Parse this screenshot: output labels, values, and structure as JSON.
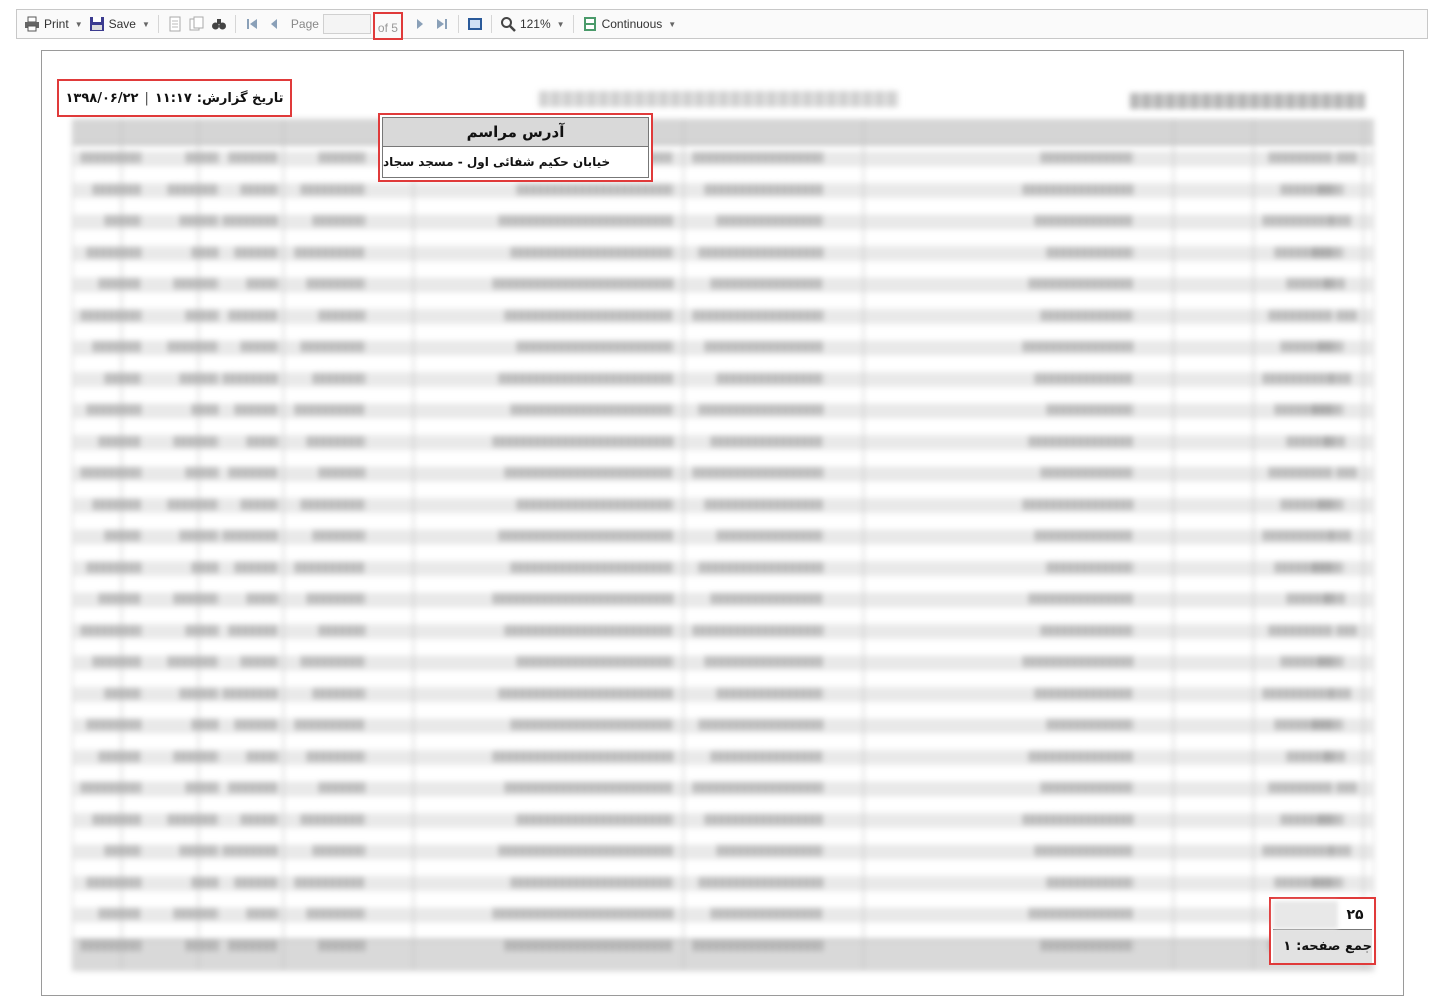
{
  "toolbar": {
    "print_label": "Print",
    "save_label": "Save",
    "page_label": "Page",
    "page_value": "",
    "of_label": "of 5",
    "zoom_label": "121%",
    "view_mode_label": "Continuous",
    "icons": [
      "printer-icon",
      "save-icon",
      "export-pages-icon",
      "copy-icon",
      "find-icon",
      "first-page-icon",
      "prev-page-icon",
      "next-page-icon",
      "last-page-icon",
      "full-screen-icon",
      "zoom-icon",
      "view-mode-icon"
    ]
  },
  "report": {
    "date_label": "تاریخ گزارش:",
    "time": "۱۱:۱۷",
    "separator": "|",
    "date": "۱۳۹۸/۰۶/۲۲",
    "address_header": "آدرس مراسم",
    "address_value": "خیابان حکیم شفائی اول - مسجد سجاد",
    "row_count": "۲۵",
    "page_total_label": "جمع صفحه:",
    "page_total_value": "۱"
  },
  "colors": {
    "highlight": "#e03a3a",
    "header_gray": "#d9d9d9",
    "row_stripe": "#e9e9e9"
  }
}
